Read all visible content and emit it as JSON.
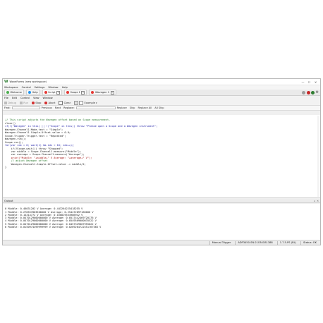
{
  "window": {
    "title": "WaveForms (new workspace)",
    "controls": [
      "—",
      "☐",
      "✕"
    ]
  },
  "menubar": [
    "Workspace",
    "Control",
    "Settings",
    "Window",
    "Help"
  ],
  "tabs": [
    {
      "label": "Welcome",
      "color": "#4caf50"
    },
    {
      "label": "Help",
      "color": "#2196f3"
    },
    {
      "label": "Script",
      "color": "#e53935",
      "active": true
    },
    {
      "label": "Scope 1",
      "color": "#e53935"
    },
    {
      "label": "Wavegen 1",
      "color": "#e53935"
    }
  ],
  "subtoolbar": [
    "File",
    "Edit",
    "Control",
    "View",
    "Window"
  ],
  "runbar": {
    "debug": "Debug",
    "run": "Run",
    "stop": "Stop",
    "abort": "Abort",
    "clear": "Clear",
    "example": "Example"
  },
  "findbar": {
    "find_label": "Find:",
    "previous": "Previous",
    "next": "Next",
    "replace_label": "Replace:",
    "replace": "Replace",
    "skip": "Skip",
    "replace_all": "Replace All",
    "all_skip": "All Skip"
  },
  "code": [
    {
      "type": "comment",
      "text": "// This script adjusts the Wavegen offset based on Scope measurement."
    },
    {
      "type": "plain",
      "text": "clear()"
    },
    {
      "type": "kw",
      "text": "if(!(\"Wavegen\" in this) || !(\"Scope\" in this)) throw \"Please open a Scope and a Wavegen instrument\";"
    },
    {
      "type": "plain",
      "text": ""
    },
    {
      "type": "plain",
      "text": "Wavegen.Channel1.Mode.text = \"Simple\";"
    },
    {
      "type": "plain",
      "text": "Wavegen.Channel1.Simple.Offset.value = 0.0;"
    },
    {
      "type": "plain",
      "text": "Scope.Trigger.Trigger.text = \"Repeated\";"
    },
    {
      "type": "plain",
      "text": "Wavegen.run();"
    },
    {
      "type": "plain",
      "text": "Scope.run();"
    },
    {
      "type": "kw",
      "text": "for(var idx = 0; wait(1) && idx < 10; idx++){"
    },
    {
      "type": "plain",
      "text": "    if(!Scope.wait()) throw \"Stopped\";"
    },
    {
      "type": "plain",
      "text": "    var middle = Scope.Channel1.measure(\"Middle\");"
    },
    {
      "type": "plain",
      "text": "    var average = Scope.Channel1.measure(\"Average\");"
    },
    {
      "type": "str",
      "text": "    print(\"Middle: \"+middle+\" V Average: \"+average+\" V\");"
    },
    {
      "type": "comment",
      "text": "    // adjust Wavegen offset"
    },
    {
      "type": "plain",
      "text": "    Wavegen.Channel1.Simple.Offset.value -= middle/2;"
    },
    {
      "type": "plain",
      "text": "}"
    }
  ],
  "output": {
    "title": "Output",
    "lines": [
      "0 Middle: 0.46031202 V Average: 0.443264225418255 V",
      "1 Middle: 0.270557803500000 V Average: 0.254472897166006 V",
      "2 Middle: 0.14314772 V Average: 0.160819534986942 V",
      "3 Middle: 0.0470129000000000 V Average: 0.0517442469720176 V",
      "4 Middle: 0.0470129000000000 V Average: 0.0549569000035522 V",
      "5 Middle: 0.0470129000000000 V Average: 0.0457329007955022 V",
      "6 Middle: 0.0150974499999999 V Average: 0.0269264722551767585 V"
    ]
  },
  "statusbar": [
    "Manual Trigger",
    "ADP3450-SN:210341B1388",
    "1.7.5-PS (BL)",
    "Status: OK"
  ]
}
